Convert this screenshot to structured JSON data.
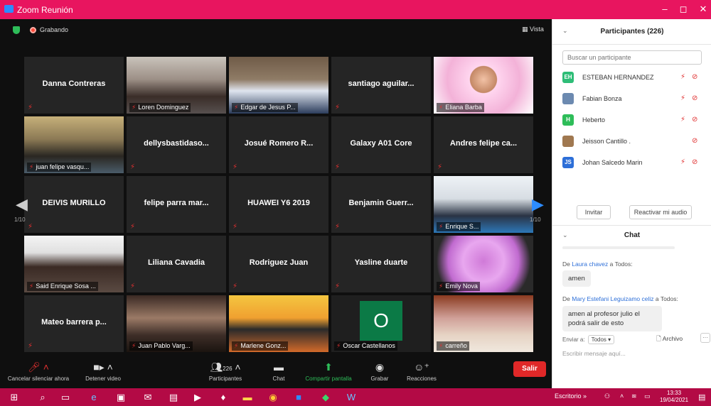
{
  "window": {
    "title": "Zoom Reunión",
    "minimize": "–",
    "maximize": "◻",
    "close": "✕"
  },
  "topbar": {
    "recording": "Grabando",
    "view": "Vista",
    "grid_icon": "grid-icon"
  },
  "colors": {
    "accent": "#e8155f",
    "muted": "#e03030",
    "active_speaker": "#a6e84a",
    "leave": "#e02828"
  },
  "tiles": [
    {
      "name": "Danna Contreras",
      "video": false
    },
    {
      "name": "Loren Dominguez",
      "video": true
    },
    {
      "name": "Edgar de Jesus P...",
      "video": true
    },
    {
      "name": "santiago aguilar...",
      "video": false
    },
    {
      "name": "Eliana Barba",
      "video": true
    },
    {
      "name": "juan felipe vasqu...",
      "video": true
    },
    {
      "name": "dellysbastidaso...",
      "video": false
    },
    {
      "name": "Josué Romero R...",
      "video": false
    },
    {
      "name": "Galaxy A01 Core",
      "video": false
    },
    {
      "name": "Andres felipe ca...",
      "video": false
    },
    {
      "name": "DEIVIS MURILLO",
      "video": false
    },
    {
      "name": "felipe parra mar...",
      "video": false
    },
    {
      "name": "HUAWEI Y6 2019",
      "video": false
    },
    {
      "name": "Benjamin Guerr...",
      "video": false
    },
    {
      "name": "Enrique S...",
      "video": true
    },
    {
      "name": "Said Enrique Sosa ...",
      "video": true
    },
    {
      "name": "Liliana Cavadia",
      "video": false
    },
    {
      "name": "Rodriguez Juan",
      "video": false
    },
    {
      "name": "Yasline duarte",
      "video": false
    },
    {
      "name": "Emily Nova",
      "video": true
    },
    {
      "name": "Mateo barrera p...",
      "video": false
    },
    {
      "name": "Juan Pablo Varg...",
      "video": true
    },
    {
      "name": "Marlene Gonz...",
      "video": true
    },
    {
      "name": "Oscar Castellanos",
      "video": true,
      "initial": "O"
    },
    {
      "name": "carreño",
      "video": true
    }
  ],
  "pager": {
    "left": "1/10",
    "right": "1/10"
  },
  "toolbar": {
    "mute": "Cancelar silenciar ahora",
    "video": "Detener video",
    "participants": "Participantes",
    "participants_count": "226",
    "chat": "Chat",
    "share": "Compartir pantalla",
    "record": "Grabar",
    "reactions": "Reacciones",
    "leave": "Salir"
  },
  "panel": {
    "title": "Participantes (226)",
    "search_placeholder": "Buscar un participante",
    "participants": [
      {
        "initials": "EH",
        "name": "ESTEBAN HERNANDEZ",
        "color": "#2ebd77"
      },
      {
        "initials": "",
        "name": "Fabian Bonza",
        "color": "#6c8ab0"
      },
      {
        "initials": "H",
        "name": "Heberto",
        "color": "#2ebd59"
      },
      {
        "initials": "",
        "name": "Jeisson Cantillo .",
        "color": "#a07850"
      },
      {
        "initials": "JS",
        "name": "Johan Salcedo Marin",
        "color": "#2d6fd8"
      }
    ],
    "invite": "Invitar",
    "unmute_all": "Reactivar mi audio"
  },
  "chat": {
    "title": "Chat",
    "messages": [
      {
        "from": "De Laura chavez a Todos:",
        "who": "Laura chavez",
        "text": "amen"
      },
      {
        "from": "De Mary Estefani Leguizamo celiz a Todos:",
        "who": "Mary Estefani Leguizamo celiz",
        "text": "amen al profesor julio el podrá salir de esto"
      }
    ],
    "send_to_label": "Enviar a:",
    "send_to_value": "Todos",
    "file": "Archivo",
    "placeholder": "Escribir mensaje aquí..."
  },
  "taskbar": {
    "desktop": "Escritorio",
    "time": "13:33",
    "date": "19/04/2021"
  }
}
